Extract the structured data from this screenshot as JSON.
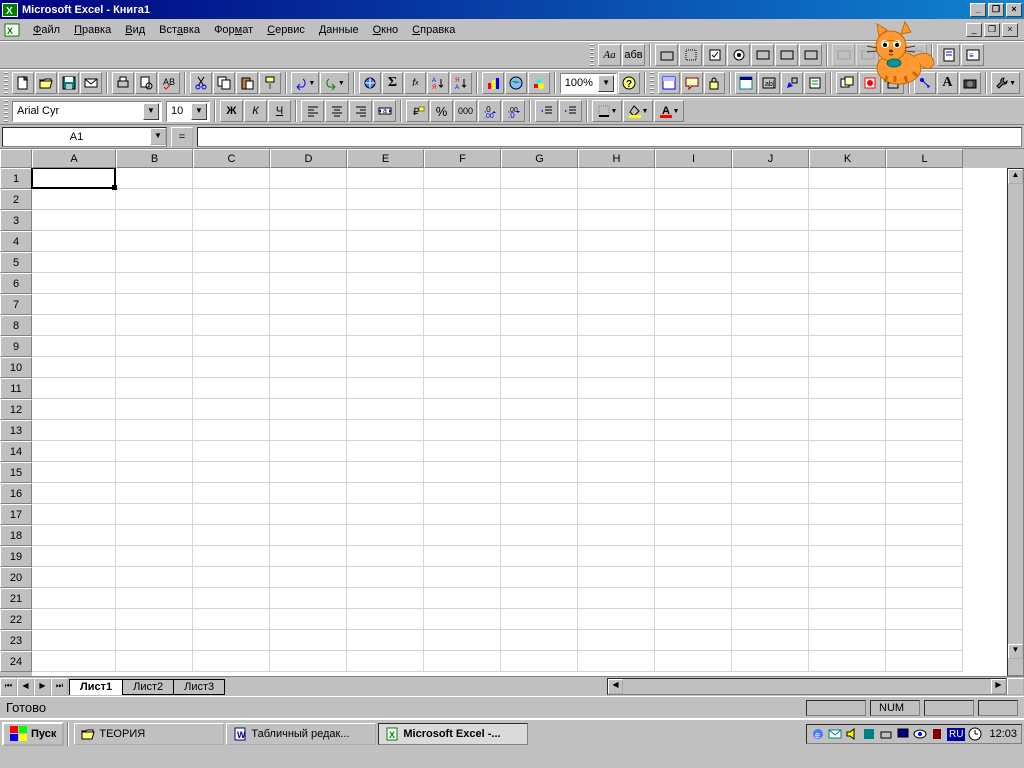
{
  "title": "Microsoft Excel - Книга1",
  "menu": [
    "Файл",
    "Правка",
    "Вид",
    "Вставка",
    "Формат",
    "Сервис",
    "Данные",
    "Окно",
    "Справка"
  ],
  "menuAccel": [
    0,
    0,
    0,
    3,
    3,
    0,
    0,
    0,
    0
  ],
  "font": {
    "name": "Arial Cyr",
    "size": "10"
  },
  "zoom": "100%",
  "nameBox": "A1",
  "columns": [
    "A",
    "B",
    "C",
    "D",
    "E",
    "F",
    "G",
    "H",
    "I",
    "J",
    "K",
    "L"
  ],
  "rows": 24,
  "sheets": [
    "Лист1",
    "Лист2",
    "Лист3"
  ],
  "activeSheet": 0,
  "status": "Готово",
  "numlock": "NUM",
  "taskbar": {
    "start": "Пуск",
    "items": [
      "ТЕОРИЯ",
      "Табличный редак...",
      "Microsoft Excel -..."
    ],
    "activeItem": 2,
    "time": "12:03",
    "lang": "RU"
  },
  "fmt": {
    "bold": "Ж",
    "italic": "К",
    "underline": "Ч",
    "currency": "₽",
    "percent": "%",
    "comma": "000",
    "aa": "Aa",
    "abv": "абв",
    "fontA": "A"
  }
}
